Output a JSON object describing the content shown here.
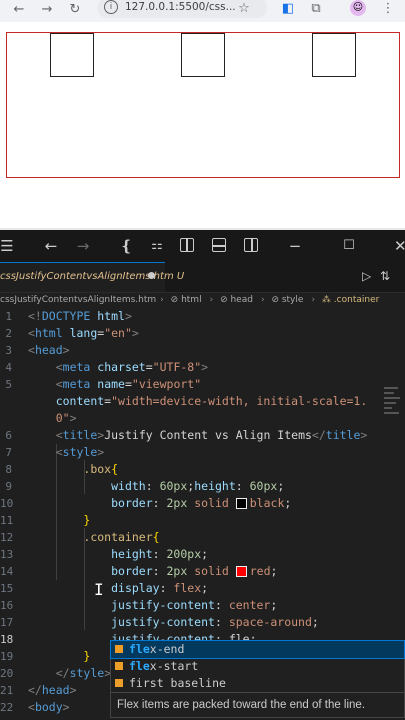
{
  "browser": {
    "url": "127.0.0.1:5500/css...",
    "nav": {
      "back": "←",
      "forward": "→",
      "reload": "↻"
    }
  },
  "vscode": {
    "tab": {
      "filename": "cssJustifyContentvsAlignItems.htm",
      "status": "U"
    },
    "breadcrumb": [
      "cssJustifyContentvsAlignItems.htm",
      "html",
      "head",
      "style",
      ".container"
    ],
    "lines": [
      {
        "n": "1",
        "parts": [
          [
            "t-punc",
            "<!"
          ],
          [
            "t-tag",
            "DOCTYPE "
          ],
          [
            "t-attr",
            "html"
          ],
          [
            "t-punc",
            ">"
          ]
        ]
      },
      {
        "n": "2",
        "parts": [
          [
            "t-punc",
            "<"
          ],
          [
            "t-tag",
            "html "
          ],
          [
            "t-attr",
            "lang"
          ],
          [
            "t-text",
            "="
          ],
          [
            "t-str",
            "\"en\""
          ],
          [
            "t-punc",
            ">"
          ]
        ]
      },
      {
        "n": "3",
        "parts": [
          [
            "t-punc",
            "<"
          ],
          [
            "t-tag",
            "head"
          ],
          [
            "t-punc",
            ">"
          ]
        ]
      },
      {
        "n": "4",
        "parts": [
          [
            "t-text",
            "    "
          ],
          [
            "t-punc",
            "<"
          ],
          [
            "t-tag",
            "meta "
          ],
          [
            "t-attr",
            "charset"
          ],
          [
            "t-text",
            "="
          ],
          [
            "t-str",
            "\"UTF-8\""
          ],
          [
            "t-punc",
            ">"
          ]
        ]
      },
      {
        "n": "5",
        "parts": [
          [
            "t-text",
            "    "
          ],
          [
            "t-punc",
            "<"
          ],
          [
            "t-tag",
            "meta "
          ],
          [
            "t-attr",
            "name"
          ],
          [
            "t-text",
            "="
          ],
          [
            "t-str",
            "\"viewport\""
          ]
        ]
      },
      {
        "n": "",
        "parts": [
          [
            "t-text",
            "    "
          ],
          [
            "t-attr",
            "content"
          ],
          [
            "t-text",
            "="
          ],
          [
            "t-str",
            "\"width=device-width, initial-scale=1."
          ]
        ]
      },
      {
        "n": "",
        "parts": [
          [
            "t-text",
            "    "
          ],
          [
            "t-str",
            "0\""
          ],
          [
            "t-punc",
            ">"
          ]
        ]
      },
      {
        "n": "6",
        "parts": [
          [
            "t-text",
            "    "
          ],
          [
            "t-punc",
            "<"
          ],
          [
            "t-tag",
            "title"
          ],
          [
            "t-punc",
            ">"
          ],
          [
            "t-text",
            "Justify Content vs Align Items"
          ],
          [
            "t-punc",
            "</"
          ],
          [
            "t-tag",
            "title"
          ],
          [
            "t-punc",
            ">"
          ]
        ]
      },
      {
        "n": "7",
        "parts": [
          [
            "t-text",
            "    "
          ],
          [
            "t-punc",
            "<"
          ],
          [
            "t-tag",
            "style"
          ],
          [
            "t-punc",
            ">"
          ]
        ]
      },
      {
        "n": "8",
        "parts": [
          [
            "t-text",
            "        "
          ],
          [
            "t-sel",
            ".box"
          ],
          [
            "t-bracket2",
            "{"
          ]
        ]
      },
      {
        "n": "9",
        "parts": [
          [
            "t-text",
            "            "
          ],
          [
            "t-prop",
            "width"
          ],
          [
            "t-text",
            ": "
          ],
          [
            "t-num",
            "60px"
          ],
          [
            "t-text",
            ";"
          ],
          [
            "t-prop",
            "height"
          ],
          [
            "t-text",
            ": "
          ],
          [
            "t-num",
            "60px"
          ],
          [
            "t-text",
            ";"
          ]
        ]
      },
      {
        "n": "10",
        "parts": [
          [
            "t-text",
            "            "
          ],
          [
            "t-prop",
            "border"
          ],
          [
            "t-text",
            ": "
          ],
          [
            "t-num",
            "2px"
          ],
          [
            "t-val",
            " solid "
          ],
          [
            "swatch",
            "#000000"
          ],
          [
            "t-val",
            "black"
          ],
          [
            "t-text",
            ";"
          ]
        ]
      },
      {
        "n": "11",
        "parts": [
          [
            "t-text",
            "        "
          ],
          [
            "t-bracket2",
            "}"
          ]
        ]
      },
      {
        "n": "12",
        "parts": [
          [
            "t-text",
            "        "
          ],
          [
            "t-sel",
            ".container"
          ],
          [
            "t-bracket2",
            "{"
          ]
        ]
      },
      {
        "n": "13",
        "parts": [
          [
            "t-text",
            "            "
          ],
          [
            "t-prop",
            "height"
          ],
          [
            "t-text",
            ": "
          ],
          [
            "t-num",
            "200px"
          ],
          [
            "t-text",
            ";"
          ]
        ]
      },
      {
        "n": "14",
        "parts": [
          [
            "t-text",
            "            "
          ],
          [
            "t-prop",
            "border"
          ],
          [
            "t-text",
            ": "
          ],
          [
            "t-num",
            "2px"
          ],
          [
            "t-val",
            " solid "
          ],
          [
            "swatch",
            "#ff0000"
          ],
          [
            "t-val",
            "red"
          ],
          [
            "t-text",
            ";"
          ]
        ]
      },
      {
        "n": "15",
        "parts": [
          [
            "t-text",
            "            "
          ],
          [
            "t-prop",
            "display"
          ],
          [
            "t-text",
            ": "
          ],
          [
            "t-val",
            "flex"
          ],
          [
            "t-text",
            ";"
          ]
        ]
      },
      {
        "n": "16",
        "parts": [
          [
            "t-text",
            "            "
          ],
          [
            "t-prop",
            "justify-content"
          ],
          [
            "t-text",
            ": "
          ],
          [
            "t-val",
            "center"
          ],
          [
            "t-text",
            ";"
          ]
        ]
      },
      {
        "n": "17",
        "parts": [
          [
            "t-text",
            "            "
          ],
          [
            "t-prop",
            "justify-content"
          ],
          [
            "t-text",
            ": "
          ],
          [
            "t-val",
            "space-around"
          ],
          [
            "t-text",
            ";"
          ]
        ]
      },
      {
        "n": "18",
        "parts": [
          [
            "t-text",
            "            "
          ],
          [
            "t-prop",
            "justify-content"
          ],
          [
            "t-text",
            ": "
          ],
          [
            "t-text",
            "fle"
          ],
          [
            "t-text",
            ";"
          ]
        ]
      },
      {
        "n": "19",
        "parts": [
          [
            "t-text",
            "        "
          ],
          [
            "t-bracket2",
            "}"
          ]
        ]
      },
      {
        "n": "20",
        "parts": [
          [
            "t-text",
            "    "
          ],
          [
            "t-punc",
            "</"
          ],
          [
            "t-tag",
            "style"
          ],
          [
            "t-punc",
            ">"
          ]
        ]
      },
      {
        "n": "21",
        "parts": [
          [
            "t-punc",
            "</"
          ],
          [
            "t-tag",
            "head"
          ],
          [
            "t-punc",
            ">"
          ]
        ]
      },
      {
        "n": "22",
        "parts": [
          [
            "t-punc",
            "<"
          ],
          [
            "t-tag",
            "body"
          ],
          [
            "t-punc",
            ">"
          ]
        ]
      }
    ],
    "suggest": {
      "items": [
        {
          "match": "fle",
          "rest": "x-end"
        },
        {
          "match": "fle",
          "rest": "x-start"
        },
        {
          "match": "",
          "rest": "first baseline"
        }
      ],
      "doc": "Flex items are packed toward the end of the line."
    }
  },
  "colors": {
    "accent": "#0078d4",
    "container_border": "#c62828",
    "suggest_selected": "#04395e"
  }
}
